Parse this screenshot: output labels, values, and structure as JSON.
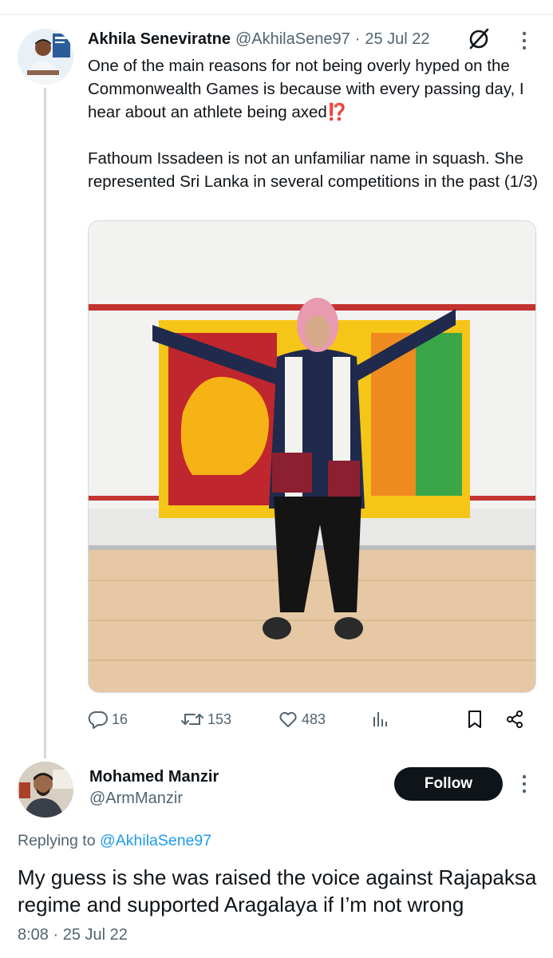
{
  "tweet": {
    "author_name": "Akhila Seneviratne",
    "author_handle": "@AkhilaSene97",
    "separator": "·",
    "date": "25 Jul 22",
    "text": "One of the main reasons for not being overly hyped on the Commonwealth Games is because with every passing day, I hear about an athlete being axed⁉️\n\nFathoum Issadeen is not an unfamiliar name in squash. She represented Sri Lanka in several competitions in the past (1/3)",
    "image_description_icon": "photo-athlete-with-flag",
    "actions": {
      "replies": "16",
      "retweets": "153",
      "likes": "483"
    }
  },
  "reply": {
    "author_name": "Mohamed Manzir",
    "author_handle": "@ArmManzir",
    "follow_label": "Follow",
    "replying_prefix": "Replying to",
    "replying_to": "@AkhilaSene97",
    "text": "My guess is she was raised the voice against Rajapaksa regime and supported Aragalaya if I’m not wrong",
    "timestamp": "8:08 · 25 Jul 22"
  },
  "colors": {
    "text_primary": "#0f1419",
    "text_secondary": "#536471",
    "link": "#1d9bf0",
    "divider": "#cfd9de",
    "follow_bg": "#0f1419"
  }
}
